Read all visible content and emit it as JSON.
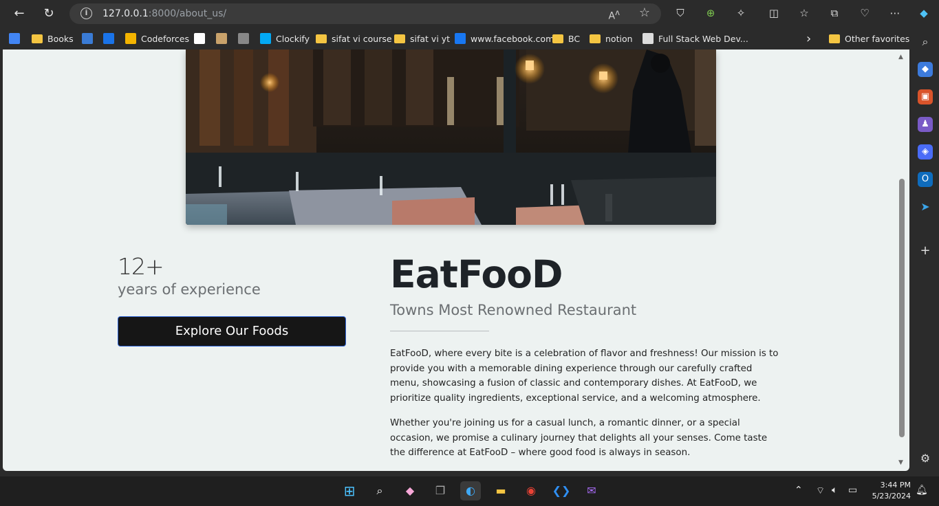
{
  "browser": {
    "url_host": "127.0.0.1",
    "url_path": ":8000/about_us/",
    "reader_icon": "read-aloud-icon",
    "favorite_icon": "star-icon"
  },
  "bookmarks": [
    {
      "label": "",
      "icon": "google-translate-icon",
      "color": "#4285f4"
    },
    {
      "label": "Books",
      "icon": "folder-icon",
      "color": "#f4c542"
    },
    {
      "label": "",
      "icon": "blue-logo-icon",
      "color": "#3a7bd5"
    },
    {
      "label": "",
      "icon": "calendar-icon",
      "color": "#1a73e8"
    },
    {
      "label": "Codeforces",
      "icon": "codeforces-icon",
      "color": "#f4b400"
    },
    {
      "label": "",
      "icon": "google-icon",
      "color": "#ffffff"
    },
    {
      "label": "",
      "icon": "codechef-icon",
      "color": "#c9a26b"
    },
    {
      "label": "",
      "icon": "cc-icon",
      "color": "#888888"
    },
    {
      "label": "Clockify",
      "icon": "clockify-icon",
      "color": "#03a9f4"
    },
    {
      "label": "sifat vi course",
      "icon": "folder-icon",
      "color": "#f4c542"
    },
    {
      "label": "sifat vi yt",
      "icon": "folder-icon",
      "color": "#f4c542"
    },
    {
      "label": "www.facebook.com",
      "icon": "facebook-icon",
      "color": "#1877f2"
    },
    {
      "label": "BC",
      "icon": "folder-icon",
      "color": "#f4c542"
    },
    {
      "label": "notion",
      "icon": "folder-icon",
      "color": "#f4c542"
    },
    {
      "label": "Full Stack Web Dev...",
      "icon": "web-icon",
      "color": "#dddddd"
    }
  ],
  "other_favorites": "Other favorites",
  "page": {
    "experience_count": "12+",
    "experience_label": "years of experience",
    "cta_label": "Explore Our Foods",
    "brand": "EatFooD",
    "tagline": "Towns Most Renowned Restaurant",
    "paragraph_1": "EatFooD, where every bite is a celebration of flavor and freshness! Our mission is to provide you with a memorable dining experience through our carefully crafted menu, showcasing a fusion of classic and contemporary dishes. At EatFooD, we prioritize quality ingredients, exceptional service, and a welcoming atmosphere.",
    "paragraph_2": "Whether you're joining us for a casual lunch, a romantic dinner, or a special occasion, we promise a culinary journey that delights all your senses. Come taste the difference at EatFooD – where good food is always in season."
  },
  "taskbar": {
    "time": "3:44 PM",
    "date": "5/23/2024"
  }
}
